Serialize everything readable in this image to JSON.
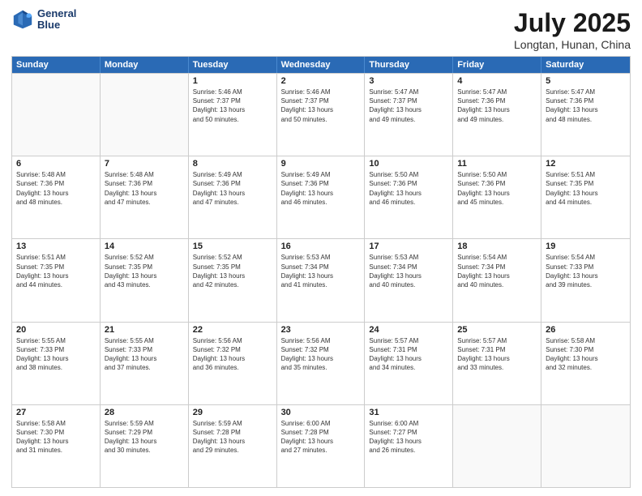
{
  "header": {
    "logo_line1": "General",
    "logo_line2": "Blue",
    "month_year": "July 2025",
    "location": "Longtan, Hunan, China"
  },
  "days_of_week": [
    "Sunday",
    "Monday",
    "Tuesday",
    "Wednesday",
    "Thursday",
    "Friday",
    "Saturday"
  ],
  "weeks": [
    [
      {
        "day": "",
        "info": ""
      },
      {
        "day": "",
        "info": ""
      },
      {
        "day": "1",
        "info": "Sunrise: 5:46 AM\nSunset: 7:37 PM\nDaylight: 13 hours\nand 50 minutes."
      },
      {
        "day": "2",
        "info": "Sunrise: 5:46 AM\nSunset: 7:37 PM\nDaylight: 13 hours\nand 50 minutes."
      },
      {
        "day": "3",
        "info": "Sunrise: 5:47 AM\nSunset: 7:37 PM\nDaylight: 13 hours\nand 49 minutes."
      },
      {
        "day": "4",
        "info": "Sunrise: 5:47 AM\nSunset: 7:36 PM\nDaylight: 13 hours\nand 49 minutes."
      },
      {
        "day": "5",
        "info": "Sunrise: 5:47 AM\nSunset: 7:36 PM\nDaylight: 13 hours\nand 48 minutes."
      }
    ],
    [
      {
        "day": "6",
        "info": "Sunrise: 5:48 AM\nSunset: 7:36 PM\nDaylight: 13 hours\nand 48 minutes."
      },
      {
        "day": "7",
        "info": "Sunrise: 5:48 AM\nSunset: 7:36 PM\nDaylight: 13 hours\nand 47 minutes."
      },
      {
        "day": "8",
        "info": "Sunrise: 5:49 AM\nSunset: 7:36 PM\nDaylight: 13 hours\nand 47 minutes."
      },
      {
        "day": "9",
        "info": "Sunrise: 5:49 AM\nSunset: 7:36 PM\nDaylight: 13 hours\nand 46 minutes."
      },
      {
        "day": "10",
        "info": "Sunrise: 5:50 AM\nSunset: 7:36 PM\nDaylight: 13 hours\nand 46 minutes."
      },
      {
        "day": "11",
        "info": "Sunrise: 5:50 AM\nSunset: 7:36 PM\nDaylight: 13 hours\nand 45 minutes."
      },
      {
        "day": "12",
        "info": "Sunrise: 5:51 AM\nSunset: 7:35 PM\nDaylight: 13 hours\nand 44 minutes."
      }
    ],
    [
      {
        "day": "13",
        "info": "Sunrise: 5:51 AM\nSunset: 7:35 PM\nDaylight: 13 hours\nand 44 minutes."
      },
      {
        "day": "14",
        "info": "Sunrise: 5:52 AM\nSunset: 7:35 PM\nDaylight: 13 hours\nand 43 minutes."
      },
      {
        "day": "15",
        "info": "Sunrise: 5:52 AM\nSunset: 7:35 PM\nDaylight: 13 hours\nand 42 minutes."
      },
      {
        "day": "16",
        "info": "Sunrise: 5:53 AM\nSunset: 7:34 PM\nDaylight: 13 hours\nand 41 minutes."
      },
      {
        "day": "17",
        "info": "Sunrise: 5:53 AM\nSunset: 7:34 PM\nDaylight: 13 hours\nand 40 minutes."
      },
      {
        "day": "18",
        "info": "Sunrise: 5:54 AM\nSunset: 7:34 PM\nDaylight: 13 hours\nand 40 minutes."
      },
      {
        "day": "19",
        "info": "Sunrise: 5:54 AM\nSunset: 7:33 PM\nDaylight: 13 hours\nand 39 minutes."
      }
    ],
    [
      {
        "day": "20",
        "info": "Sunrise: 5:55 AM\nSunset: 7:33 PM\nDaylight: 13 hours\nand 38 minutes."
      },
      {
        "day": "21",
        "info": "Sunrise: 5:55 AM\nSunset: 7:33 PM\nDaylight: 13 hours\nand 37 minutes."
      },
      {
        "day": "22",
        "info": "Sunrise: 5:56 AM\nSunset: 7:32 PM\nDaylight: 13 hours\nand 36 minutes."
      },
      {
        "day": "23",
        "info": "Sunrise: 5:56 AM\nSunset: 7:32 PM\nDaylight: 13 hours\nand 35 minutes."
      },
      {
        "day": "24",
        "info": "Sunrise: 5:57 AM\nSunset: 7:31 PM\nDaylight: 13 hours\nand 34 minutes."
      },
      {
        "day": "25",
        "info": "Sunrise: 5:57 AM\nSunset: 7:31 PM\nDaylight: 13 hours\nand 33 minutes."
      },
      {
        "day": "26",
        "info": "Sunrise: 5:58 AM\nSunset: 7:30 PM\nDaylight: 13 hours\nand 32 minutes."
      }
    ],
    [
      {
        "day": "27",
        "info": "Sunrise: 5:58 AM\nSunset: 7:30 PM\nDaylight: 13 hours\nand 31 minutes."
      },
      {
        "day": "28",
        "info": "Sunrise: 5:59 AM\nSunset: 7:29 PM\nDaylight: 13 hours\nand 30 minutes."
      },
      {
        "day": "29",
        "info": "Sunrise: 5:59 AM\nSunset: 7:28 PM\nDaylight: 13 hours\nand 29 minutes."
      },
      {
        "day": "30",
        "info": "Sunrise: 6:00 AM\nSunset: 7:28 PM\nDaylight: 13 hours\nand 27 minutes."
      },
      {
        "day": "31",
        "info": "Sunrise: 6:00 AM\nSunset: 7:27 PM\nDaylight: 13 hours\nand 26 minutes."
      },
      {
        "day": "",
        "info": ""
      },
      {
        "day": "",
        "info": ""
      }
    ]
  ]
}
